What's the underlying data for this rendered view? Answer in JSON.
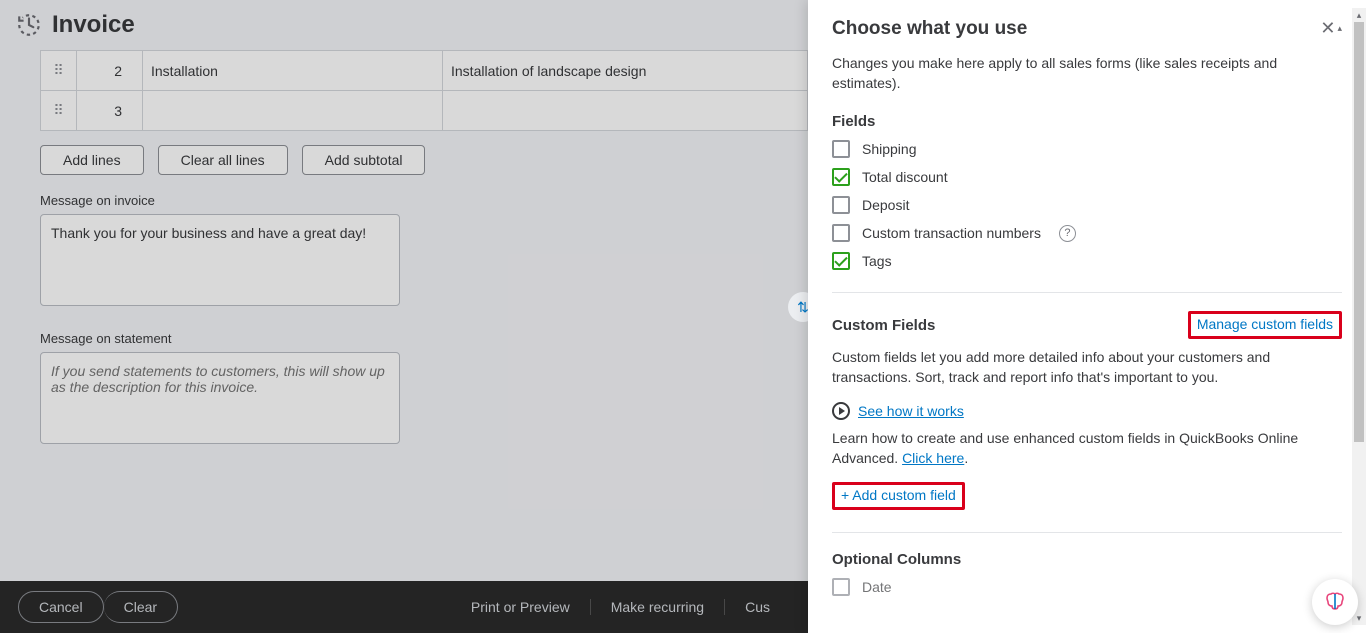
{
  "header": {
    "title": "Invoice"
  },
  "lines": [
    {
      "num": "2",
      "product": "Installation",
      "description": "Installation of landscape design"
    },
    {
      "num": "3",
      "product": "",
      "description": ""
    }
  ],
  "buttons": {
    "add_lines": "Add lines",
    "clear_lines": "Clear all lines",
    "add_subtotal": "Add subtotal"
  },
  "message_invoice": {
    "label": "Message on invoice",
    "value": "Thank you for your business and have a great day!"
  },
  "message_statement": {
    "label": "Message on statement",
    "placeholder": "If you send statements to customers, this will show up as the description for this invoice."
  },
  "footer": {
    "cancel": "Cancel",
    "clear": "Clear",
    "print": "Print or Preview",
    "recurring": "Make recurring",
    "customize": "Cus"
  },
  "panel": {
    "title": "Choose what you use",
    "description": "Changes you make here apply to all sales forms (like sales receipts and estimates).",
    "fields_heading": "Fields",
    "fields": [
      {
        "label": "Shipping",
        "checked": false
      },
      {
        "label": "Total discount",
        "checked": true
      },
      {
        "label": "Deposit",
        "checked": false
      },
      {
        "label": "Custom transaction numbers",
        "checked": false,
        "help": true
      },
      {
        "label": "Tags",
        "checked": true
      }
    ],
    "custom_fields_heading": "Custom Fields",
    "manage_link": "Manage custom fields",
    "custom_fields_desc": "Custom fields let you add more detailed info about your customers and transactions. Sort, track and report info that's important to you.",
    "see_how": "See how it works",
    "learn_text_a": "Learn how to create and use enhanced custom fields in QuickBooks Online Advanced. ",
    "learn_link": "Click here",
    "learn_text_b": ".",
    "add_custom": "+ Add custom field",
    "optional_heading": "Optional Columns",
    "optional_first": "Date"
  }
}
